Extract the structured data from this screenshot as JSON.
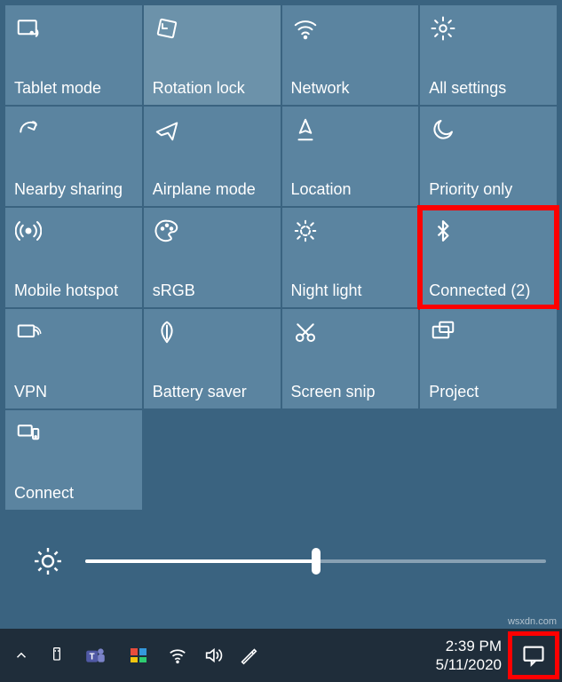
{
  "tiles": [
    {
      "id": "tablet-mode",
      "label": "Tablet mode",
      "icon": "tablet",
      "style": "normal"
    },
    {
      "id": "rotation-lock",
      "label": "Rotation lock",
      "icon": "rotation",
      "style": "dim"
    },
    {
      "id": "network",
      "label": "Network",
      "icon": "wifi",
      "style": "normal"
    },
    {
      "id": "all-settings",
      "label": "All settings",
      "icon": "gear",
      "style": "normal"
    },
    {
      "id": "nearby-sharing",
      "label": "Nearby sharing",
      "icon": "share",
      "style": "normal"
    },
    {
      "id": "airplane-mode",
      "label": "Airplane mode",
      "icon": "airplane",
      "style": "normal"
    },
    {
      "id": "location",
      "label": "Location",
      "icon": "location",
      "style": "normal"
    },
    {
      "id": "priority-only",
      "label": "Priority only",
      "icon": "moon",
      "style": "normal"
    },
    {
      "id": "mobile-hotspot",
      "label": "Mobile hotspot",
      "icon": "hotspot",
      "style": "normal"
    },
    {
      "id": "srgb",
      "label": "sRGB",
      "icon": "palette",
      "style": "normal"
    },
    {
      "id": "night-light",
      "label": "Night light",
      "icon": "sun-dim",
      "style": "normal"
    },
    {
      "id": "bluetooth",
      "label": "Connected (2)",
      "icon": "bluetooth",
      "style": "normal",
      "highlight": true
    },
    {
      "id": "vpn",
      "label": "VPN",
      "icon": "vpn",
      "style": "normal"
    },
    {
      "id": "battery-saver",
      "label": "Battery saver",
      "icon": "leaf",
      "style": "normal"
    },
    {
      "id": "screen-snip",
      "label": "Screen snip",
      "icon": "snip",
      "style": "normal"
    },
    {
      "id": "project",
      "label": "Project",
      "icon": "project",
      "style": "normal"
    },
    {
      "id": "connect",
      "label": "Connect",
      "icon": "connect",
      "style": "normal"
    }
  ],
  "brightness": {
    "percent": 50
  },
  "taskbar": {
    "time": "2:39 PM",
    "date": "5/11/2020"
  },
  "watermark": "wsxdn.com"
}
